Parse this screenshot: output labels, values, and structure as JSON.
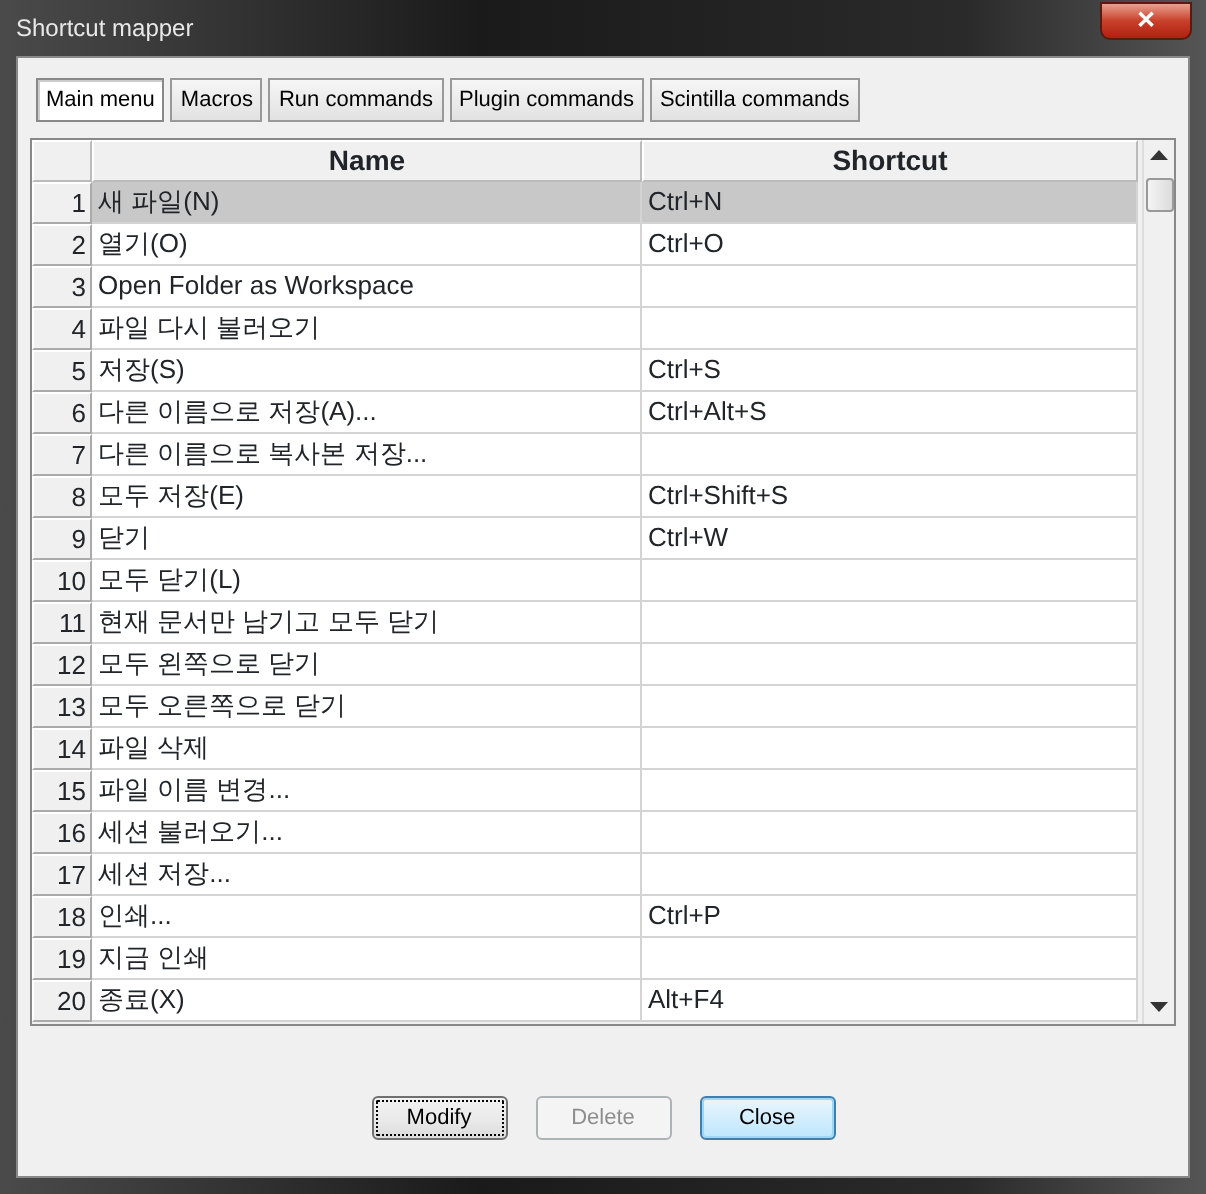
{
  "window": {
    "title": "Shortcut mapper",
    "close_button": "✕"
  },
  "tabs": [
    {
      "label": "Main menu",
      "selected": true
    },
    {
      "label": "Macros",
      "selected": false
    },
    {
      "label": "Run commands",
      "selected": false
    },
    {
      "label": "Plugin commands",
      "selected": false
    },
    {
      "label": "Scintilla commands",
      "selected": false
    }
  ],
  "table": {
    "columns": [
      "Name",
      "Shortcut"
    ],
    "rows": [
      {
        "number": "1",
        "name": "새 파일(N)",
        "shortcut": "Ctrl+N",
        "selected": true
      },
      {
        "number": "2",
        "name": "열기(O)",
        "shortcut": "Ctrl+O",
        "selected": false
      },
      {
        "number": "3",
        "name": "Open Folder as Workspace",
        "selected": false
      },
      {
        "number": "4",
        "name": "파일 다시 불러오기",
        "selected": false
      },
      {
        "number": "5",
        "name": "저장(S)",
        "shortcut": "Ctrl+S",
        "selected": false
      },
      {
        "number": "6",
        "name": "다른 이름으로 저장(A)...",
        "shortcut": "Ctrl+Alt+S",
        "selected": false
      },
      {
        "number": "7",
        "name": "다른 이름으로 복사본 저장...",
        "selected": false
      },
      {
        "number": "8",
        "name": "모두 저장(E)",
        "shortcut": "Ctrl+Shift+S",
        "selected": false
      },
      {
        "number": "9",
        "name": "닫기",
        "shortcut": "Ctrl+W",
        "selected": false
      },
      {
        "number": "10",
        "name": "모두 닫기(L)",
        "selected": false
      },
      {
        "number": "11",
        "name": "현재 문서만 남기고 모두 닫기",
        "selected": false
      },
      {
        "number": "12",
        "name": "모두 왼쪽으로 닫기",
        "selected": false
      },
      {
        "number": "13",
        "name": "모두 오른쪽으로 닫기",
        "selected": false
      },
      {
        "number": "14",
        "name": "파일 삭제",
        "selected": false
      },
      {
        "number": "15",
        "name": "파일 이름 변경...",
        "selected": false
      },
      {
        "number": "16",
        "name": "세션 불러오기...",
        "selected": false
      },
      {
        "number": "17",
        "name": "세션 저장...",
        "selected": false
      },
      {
        "number": "18",
        "name": "인쇄...",
        "shortcut": "Ctrl+P",
        "selected": false
      },
      {
        "number": "19",
        "name": "지금 인쇄",
        "selected": false
      },
      {
        "number": "20",
        "name": "종료(X)",
        "shortcut": "Alt+F4",
        "selected": false
      }
    ]
  },
  "buttons": [
    {
      "label": "Modify",
      "disabled": false,
      "focused": true,
      "default": false
    },
    {
      "label": "Delete",
      "disabled": true,
      "focused": false,
      "default": false
    },
    {
      "label": "Close",
      "disabled": false,
      "focused": false,
      "default": true
    }
  ]
}
